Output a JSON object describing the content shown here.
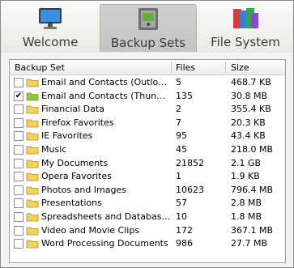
{
  "tabs": [
    {
      "label": "Welcome",
      "icon": "monitor-icon",
      "active": false
    },
    {
      "label": "Backup Sets",
      "icon": "safe-icon",
      "active": true
    },
    {
      "label": "File System",
      "icon": "file-cabinet-icon",
      "active": false
    }
  ],
  "list": {
    "columns": {
      "name": "Backup Set",
      "files": "Files",
      "size": "Size"
    },
    "rows": [
      {
        "name": "Email and Contacts (Outlook E...",
        "files": "5",
        "size": "468.7 KB",
        "checked": false,
        "highlight": false
      },
      {
        "name": "Email and Contacts (Thunderb...",
        "files": "135",
        "size": "30.8 MB",
        "checked": true,
        "highlight": true
      },
      {
        "name": "Financial Data",
        "files": "2",
        "size": "355.4 KB",
        "checked": false,
        "highlight": false
      },
      {
        "name": "Firefox Favorites",
        "files": "7",
        "size": "20.3 KB",
        "checked": false,
        "highlight": false
      },
      {
        "name": "IE Favorites",
        "files": "95",
        "size": "43.4 KB",
        "checked": false,
        "highlight": false
      },
      {
        "name": "Music",
        "files": "45",
        "size": "218.0 MB",
        "checked": false,
        "highlight": false
      },
      {
        "name": "My Documents",
        "files": "21852",
        "size": "2.1 GB",
        "checked": false,
        "highlight": false
      },
      {
        "name": "Opera Favorites",
        "files": "1",
        "size": "1.9 KB",
        "checked": false,
        "highlight": false
      },
      {
        "name": "Photos and Images",
        "files": "10623",
        "size": "796.4 MB",
        "checked": false,
        "highlight": false
      },
      {
        "name": "Presentations",
        "files": "57",
        "size": "2.8 MB",
        "checked": false,
        "highlight": false
      },
      {
        "name": "Spreadsheets and Databases",
        "files": "10",
        "size": "1.8 MB",
        "checked": false,
        "highlight": false
      },
      {
        "name": "Video and Movie Clips",
        "files": "172",
        "size": "367.1 MB",
        "checked": false,
        "highlight": false
      },
      {
        "name": "Word Processing Documents",
        "files": "986",
        "size": "27.7 MB",
        "checked": false,
        "highlight": false
      }
    ]
  },
  "colors": {
    "folder": "#f2d35c",
    "folder_highlight": "#8cc63f",
    "active_tab": "#c8c8c8"
  }
}
